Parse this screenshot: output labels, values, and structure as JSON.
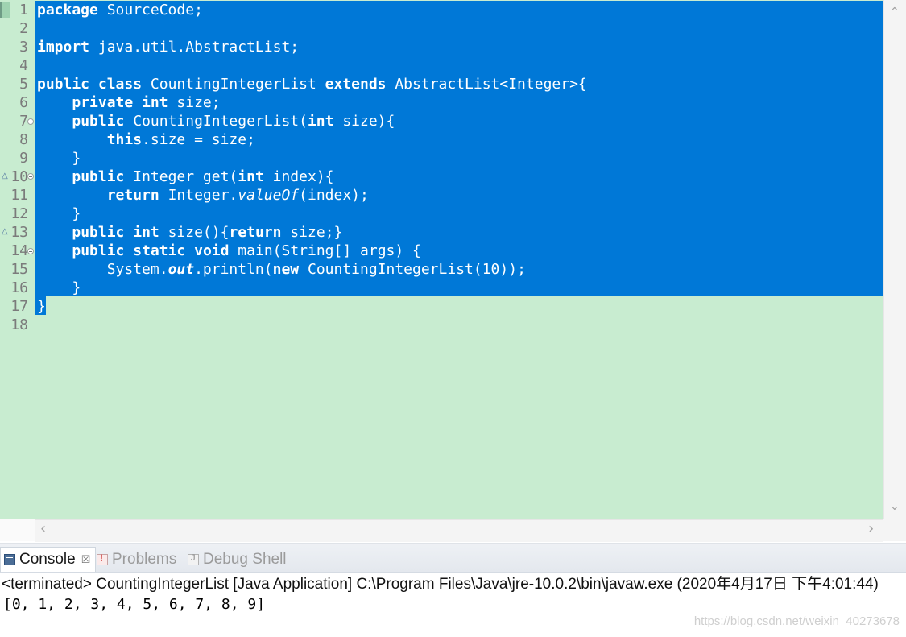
{
  "editor": {
    "gutter_numbers": [
      "1",
      "2",
      "3",
      "4",
      "5",
      "6",
      "7",
      "8",
      "9",
      "10",
      "11",
      "12",
      "13",
      "14",
      "15",
      "16",
      "17",
      "18"
    ],
    "code": {
      "l1_kw": "package",
      "l1_rest": " SourceCode;",
      "l3_kw": "import",
      "l3_rest": " java.util.AbstractList;",
      "l5_kw1": "public",
      "l5_kw2": "class",
      "l5_name": " CountingIntegerList ",
      "l5_kw3": "extends",
      "l5_rest": " AbstractList<Integer>{",
      "l6_kw1": "private",
      "l6_kw2": "int",
      "l6_rest": " size;",
      "l7_kw1": "public",
      "l7_mid": " CountingIntegerList(",
      "l7_kw2": "int",
      "l7_rest": " size){",
      "l8_kw": "this",
      "l8_rest": ".size = size;",
      "l9": "}",
      "l10_kw1": "public",
      "l10_mid": " Integer get(",
      "l10_kw2": "int",
      "l10_rest": " index){",
      "l11_kw": "return",
      "l11_mid": " Integer.",
      "l11_it": "valueOf",
      "l11_rest": "(index);",
      "l12": "}",
      "l13_kw1": "public",
      "l13_kw2": "int",
      "l13_mid": " size(){",
      "l13_kw3": "return",
      "l13_rest": " size;}",
      "l14_kw1": "public",
      "l14_kw2": "static",
      "l14_kw3": "void",
      "l14_rest": " main(String[] args) {",
      "l15_pre": "System.",
      "l15_it": "out",
      "l15_mid": ".println(",
      "l15_kw": "new",
      "l15_rest": " CountingIntegerList(10));",
      "l16": "}",
      "l17": "}"
    },
    "scroll": {
      "up": "⌃",
      "down": "⌄",
      "left": "‹",
      "right": "›"
    }
  },
  "console": {
    "tabs": [
      {
        "label": "Console",
        "icon": "console-icon",
        "close": "☒"
      },
      {
        "label": "Problems",
        "icon": "problems-icon"
      },
      {
        "label": "Debug Shell",
        "icon": "debug-shell-icon"
      }
    ],
    "status": "<terminated> CountingIntegerList [Java Application] C:\\Program Files\\Java\\jre-10.0.2\\bin\\javaw.exe (2020年4月17日 下午4:01:44)",
    "output": "[0, 1, 2, 3, 4, 5, 6, 7, 8, 9]",
    "watermark": "https://blog.csdn.net/weixin_40273678"
  },
  "colors": {
    "selection": "#0078d7",
    "editor_background": "#c8ecd0",
    "gutter_text": "#7b7b7b"
  }
}
